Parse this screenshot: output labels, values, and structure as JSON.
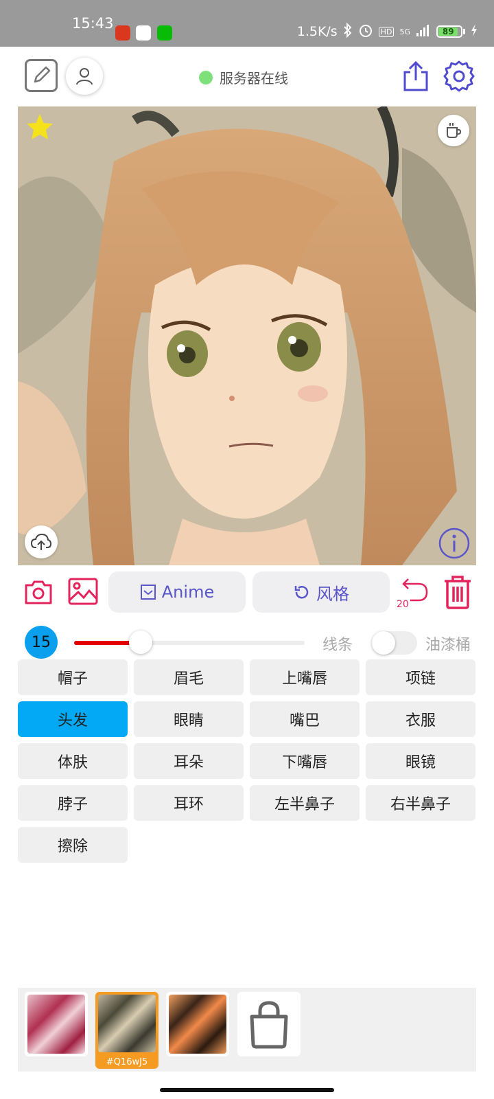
{
  "status_bar": {
    "time": "15:43",
    "net_speed": "1.5K/s",
    "network": "5G",
    "hd": "HD",
    "battery": "89"
  },
  "toolbar": {
    "server_status": "服务器在线",
    "server_status_color": "#7ee07a"
  },
  "action_row": {
    "anime_label": "Anime",
    "style_label": "风格",
    "undo_count": "20",
    "accent_color": "#e3245c",
    "button_text_color": "#5a55c8"
  },
  "brush": {
    "size": "15",
    "slider_value": 0.29,
    "line_label": "线条",
    "bucket_label": "油漆桶",
    "bucket_enabled": false
  },
  "parts": [
    {
      "label": "帽子",
      "active": false
    },
    {
      "label": "眉毛",
      "active": false
    },
    {
      "label": "上嘴唇",
      "active": false
    },
    {
      "label": "项链",
      "active": false
    },
    {
      "label": "头发",
      "active": true
    },
    {
      "label": "眼睛",
      "active": false
    },
    {
      "label": "嘴巴",
      "active": false
    },
    {
      "label": "衣服",
      "active": false
    },
    {
      "label": "体肤",
      "active": false
    },
    {
      "label": "耳朵",
      "active": false
    },
    {
      "label": "下嘴唇",
      "active": false
    },
    {
      "label": "眼镜",
      "active": false
    },
    {
      "label": "脖子",
      "active": false
    },
    {
      "label": "耳环",
      "active": false
    },
    {
      "label": "左半鼻子",
      "active": false
    },
    {
      "label": "右半鼻子",
      "active": false
    },
    {
      "label": "擦除",
      "active": false
    }
  ],
  "gallery": {
    "selected_code": "#Q16wJ5",
    "selected_color": "#f59b22"
  }
}
